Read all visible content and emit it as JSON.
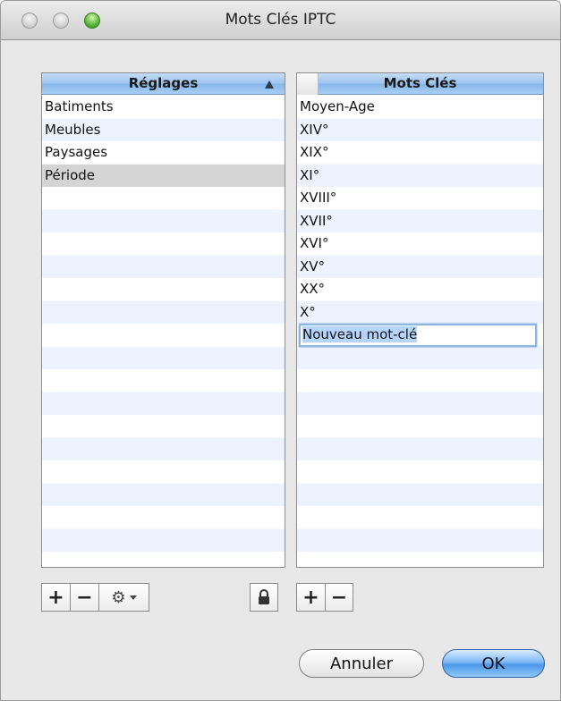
{
  "window": {
    "title": "Mots Clés IPTC"
  },
  "settings_table": {
    "header": "Réglages",
    "rows": [
      "Batiments",
      "Meubles",
      "Paysages",
      "Période"
    ],
    "selected_index": 3
  },
  "keywords_table": {
    "header": "Mots Clés",
    "rows": [
      "Moyen-Age",
      "XIV°",
      "XIX°",
      "XI°",
      "XVIII°",
      "XVII°",
      "XVI°",
      "XV°",
      "XX°",
      "X°"
    ],
    "editing_value": "Nouveau mot-clé"
  },
  "toolbar": {
    "add_label": "+",
    "remove_label": "−"
  },
  "buttons": {
    "cancel": "Annuler",
    "ok": "OK"
  },
  "icons": {
    "gear": "⚙",
    "lock": "lock-icon"
  },
  "colors": {
    "header_blue": "#9cc3ee",
    "stripe": "#edf3fe",
    "ok_blue": "#4c97e8"
  }
}
